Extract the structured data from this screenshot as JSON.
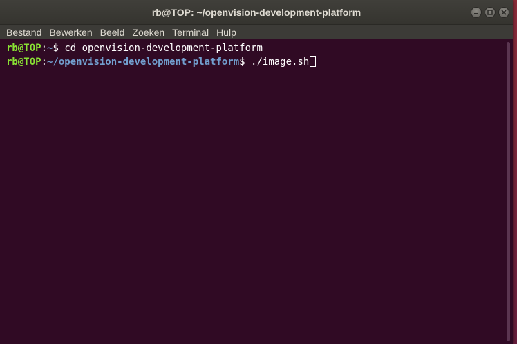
{
  "window": {
    "title": "rb@TOP: ~/openvision-development-platform"
  },
  "titlebar_buttons": [
    {
      "name": "minimize-button",
      "icon": "minimize-icon"
    },
    {
      "name": "maximize-button",
      "icon": "maximize-icon"
    },
    {
      "name": "close-button",
      "icon": "close-icon"
    }
  ],
  "menu": {
    "items": [
      "Bestand",
      "Bewerken",
      "Beeld",
      "Zoeken",
      "Terminal",
      "Hulp"
    ]
  },
  "terminal": {
    "lines": [
      {
        "user_host": "rb@TOP",
        "sep": ":",
        "path": "~",
        "prompt": "$ ",
        "command": "cd openvision-development-platform"
      },
      {
        "user_host": "rb@TOP",
        "sep": ":",
        "path": "~/openvision-development-platform",
        "prompt": "$ ",
        "command": "./image.sh"
      }
    ]
  },
  "colors": {
    "terminal_bg": "#300a24",
    "prompt_user": "#8ae234",
    "prompt_path": "#729fcf",
    "titlebar": "#3c3b37"
  }
}
